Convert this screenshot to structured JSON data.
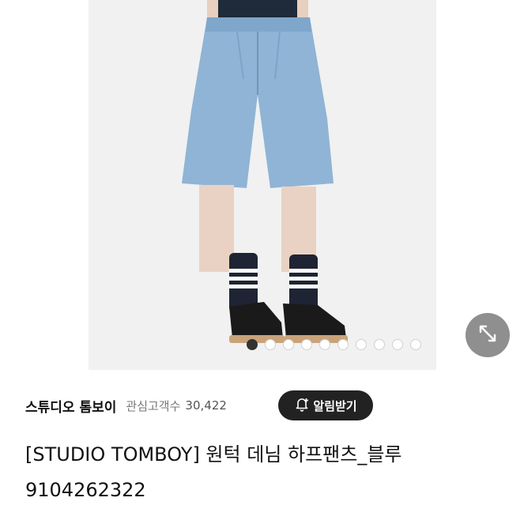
{
  "gallery": {
    "slide_count": 10,
    "active_index": 0
  },
  "shop": {
    "name": "스튜디오 톰보이",
    "favorites_label": "관심고객수",
    "favorites_count": "30,422",
    "alert_button_label": "알림받기"
  },
  "product": {
    "title": "[STUDIO TOMBOY] 원턱 데님 하프팬츠_블루 9104262322"
  },
  "icons": {
    "expand": "expand-arrows-icon",
    "alert": "bell-plus-icon"
  },
  "colors": {
    "alert_button_bg": "#222222",
    "expand_button_bg": "#8f8f8f",
    "denim": "#8fb4d6"
  }
}
